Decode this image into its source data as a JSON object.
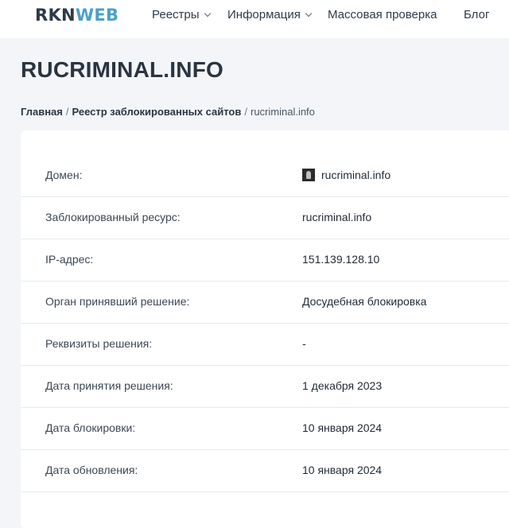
{
  "header": {
    "logo_part1": "RKN",
    "logo_part2": "WEB",
    "nav": {
      "registries": "Реестры",
      "info": "Информация",
      "mass_check": "Массовая проверка",
      "blog": "Блог"
    }
  },
  "page": {
    "title": "RUCRIMINAL.INFO"
  },
  "breadcrumb": {
    "home": "Главная",
    "registry": "Реестр заблокированных сайтов",
    "current": "rucriminal.info"
  },
  "details": {
    "domain": {
      "label": "Домен:",
      "value": "rucriminal.info"
    },
    "blocked_resource": {
      "label": "Заблокированный ресурс:",
      "value": "rucriminal.info"
    },
    "ip": {
      "label": "IP-адрес:",
      "value": "151.139.128.10"
    },
    "authority": {
      "label": "Орган принявший решение:",
      "value": "Досудебная блокировка"
    },
    "decision_details": {
      "label": "Реквизиты решения:",
      "value": "-"
    },
    "decision_date": {
      "label": "Дата принятия решения:",
      "value": "1 декабря 2023"
    },
    "block_date": {
      "label": "Дата блокировки:",
      "value": "10 января 2024"
    },
    "update_date": {
      "label": "Дата обновления:",
      "value": "10 января 2024"
    }
  },
  "icons": {
    "favicon": "site-favicon-icon",
    "dropdown": "chevron-down-icon"
  }
}
